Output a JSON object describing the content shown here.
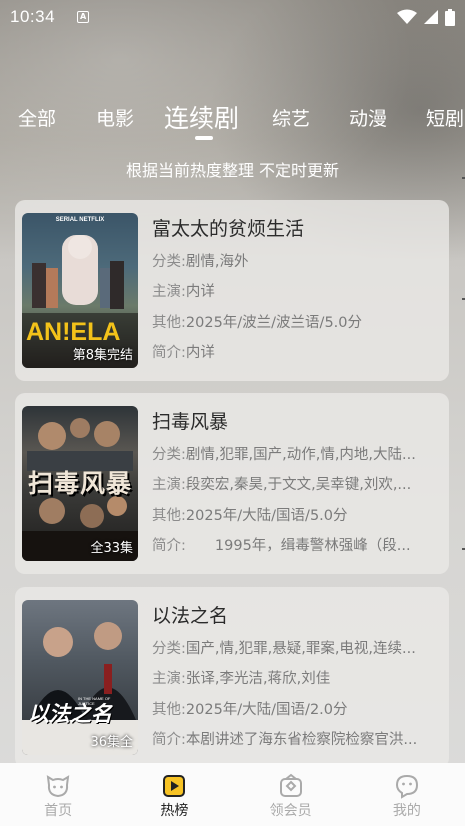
{
  "status_bar": {
    "time": "10:34",
    "notif_glyph": "A"
  },
  "tabs": [
    {
      "label": "全部"
    },
    {
      "label": "电影"
    },
    {
      "label": "连续剧",
      "active": true
    },
    {
      "label": "综艺"
    },
    {
      "label": "动漫"
    },
    {
      "label": "短剧"
    }
  ],
  "subtitle": "根据当前热度整理 不定时更新",
  "cards": [
    {
      "title": "富太太的贫烦生活",
      "category_label": "分类:",
      "category": "剧情,海外",
      "cast_label": "主演:",
      "cast": "内详",
      "other_label": "其他:",
      "other": "2025年/波兰/波兰语/5.0分",
      "intro_label": "简介:",
      "intro": "内详",
      "badge": "第8集完结",
      "poster_top_text": "SERIAL NETFLIX",
      "poster_title": "AN!ELA"
    },
    {
      "title": "扫毒风暴",
      "category_label": "分类:",
      "category": "剧情,犯罪,国产,动作,情,内地,大陆...",
      "cast_label": "主演:",
      "cast": "段奕宏,秦昊,于文文,吴幸键,刘欢,...",
      "other_label": "其他:",
      "other": "2025年/大陆/国语/5.0分",
      "intro_label": "简介:",
      "intro": "　　1995年，缉毒警林强峰（段...",
      "badge": "全33集",
      "poster_title": "扫毒风暴"
    },
    {
      "title": "以法之名",
      "category_label": "分类:",
      "category": "国产,情,犯罪,悬疑,罪案,电视,连续...",
      "cast_label": "主演:",
      "cast": "张译,李光洁,蒋欣,刘佳",
      "other_label": "其他:",
      "other": "2025年/大陆/国语/2.0分",
      "intro_label": "简介:",
      "intro": "本剧讲述了海东省检察院检察官洪...",
      "badge": "36集全",
      "poster_title": "以法之名",
      "poster_subtitle": "IN THE NAME OF JUSTICE"
    }
  ],
  "bottom_nav": [
    {
      "label": "首页",
      "icon": "home-face-icon"
    },
    {
      "label": "热榜",
      "icon": "play-icon",
      "active": true
    },
    {
      "label": "领会员",
      "icon": "gift-icon"
    },
    {
      "label": "我的",
      "icon": "smile-icon"
    }
  ],
  "colors": {
    "accent": "#f7c325",
    "text_dark": "#2b2b2b",
    "text_muted": "#7b7b7b"
  }
}
